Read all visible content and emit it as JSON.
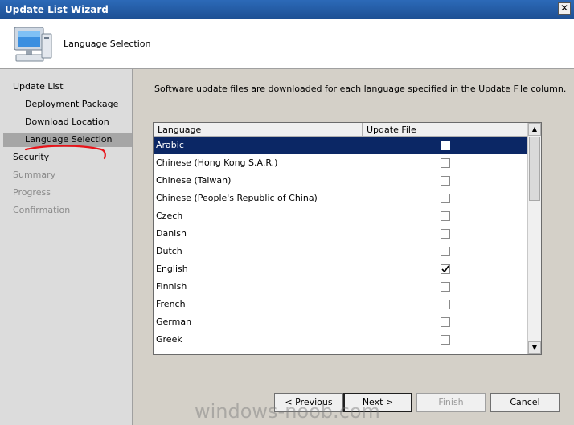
{
  "window": {
    "title": "Update List Wizard",
    "close_glyph": "✕"
  },
  "header": {
    "title": "Language Selection",
    "icon": "computer-monitor-icon"
  },
  "nav": {
    "items": [
      {
        "label": "Update List",
        "level": "top",
        "state": "normal"
      },
      {
        "label": "Deployment Package",
        "level": "sub",
        "state": "normal"
      },
      {
        "label": "Download Location",
        "level": "sub",
        "state": "normal"
      },
      {
        "label": "Language Selection",
        "level": "sub",
        "state": "selected"
      },
      {
        "label": "Security",
        "level": "top",
        "state": "normal"
      },
      {
        "label": "Summary",
        "level": "top",
        "state": "disabled"
      },
      {
        "label": "Progress",
        "level": "top",
        "state": "disabled"
      },
      {
        "label": "Confirmation",
        "level": "top",
        "state": "disabled"
      }
    ]
  },
  "main": {
    "description": "Software update files are downloaded for each language specified in the Update File column.",
    "columns": {
      "language": "Language",
      "update_file": "Update File"
    },
    "rows": [
      {
        "language": "Arabic",
        "checked": false,
        "selected": true
      },
      {
        "language": "Chinese (Hong Kong S.A.R.)",
        "checked": false
      },
      {
        "language": "Chinese (Taiwan)",
        "checked": false
      },
      {
        "language": "Chinese (People's Republic of China)",
        "checked": false
      },
      {
        "language": "Czech",
        "checked": false
      },
      {
        "language": "Danish",
        "checked": false
      },
      {
        "language": "Dutch",
        "checked": false
      },
      {
        "language": "English",
        "checked": true
      },
      {
        "language": "Finnish",
        "checked": false
      },
      {
        "language": "French",
        "checked": false
      },
      {
        "language": "German",
        "checked": false
      },
      {
        "language": "Greek",
        "checked": false
      }
    ]
  },
  "buttons": {
    "previous": "< Previous",
    "next": "Next >",
    "finish": "Finish",
    "cancel": "Cancel"
  },
  "watermark": "windows-noob.com",
  "colors": {
    "selection": "#0b2765",
    "nav_selected": "#a6a6a6",
    "annotation_underline": "#e8141a"
  }
}
